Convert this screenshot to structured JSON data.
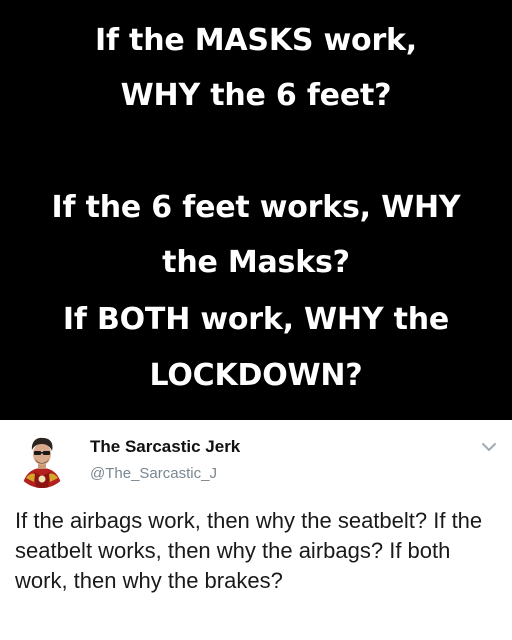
{
  "meme": {
    "lines": [
      "If the MASKS work,",
      "WHY the 6 feet?",
      "If the 6 feet works, WHY",
      "the Masks?",
      "If BOTH work, WHY the",
      "LOCKDOWN?"
    ],
    "background_color": "#000000",
    "text_color": "#ffffff"
  },
  "tweet": {
    "display_name": "The Sarcastic Jerk",
    "handle": "@The_Sarcastic_J",
    "avatar_icon": "iron-man-avatar",
    "menu_icon": "chevron-down-icon",
    "text": "If the airbags work, then why the seatbelt? If the seatbelt works, then why the airbags? If both work, then why the brakes?",
    "handle_color": "#7a8790"
  }
}
